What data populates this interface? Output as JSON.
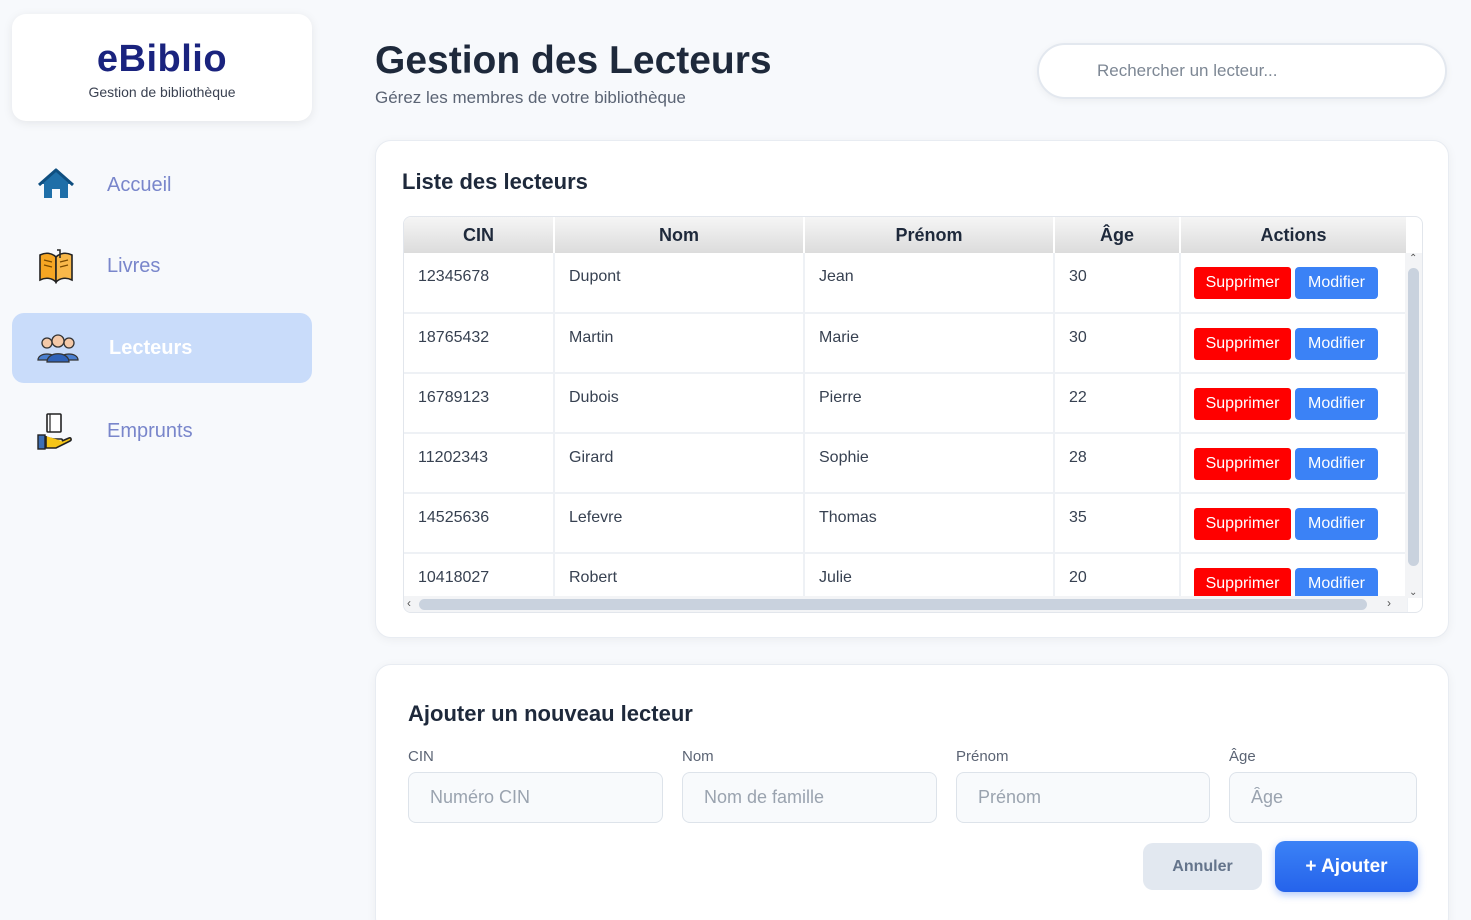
{
  "brand": {
    "title": "eBiblio",
    "subtitle": "Gestion de bibliothèque"
  },
  "sidebar": {
    "items": [
      {
        "label": "Accueil",
        "icon": "home-icon",
        "active": false
      },
      {
        "label": "Livres",
        "icon": "book-icon",
        "active": false
      },
      {
        "label": "Lecteurs",
        "icon": "readers-group-icon",
        "active": true
      },
      {
        "label": "Emprunts",
        "icon": "book-loan-hand-icon",
        "active": false
      }
    ]
  },
  "header": {
    "title": "Gestion des Lecteurs",
    "subtitle": "Gérez les membres de votre bibliothèque",
    "search_placeholder": "Rechercher un lecteur..."
  },
  "list": {
    "title": "Liste des lecteurs",
    "columns": [
      "CIN",
      "Nom",
      "Prénom",
      "Âge",
      "Actions"
    ],
    "delete_label": "Supprimer",
    "edit_label": "Modifier",
    "rows": [
      {
        "cin": "12345678",
        "nom": "Dupont",
        "prenom": "Jean",
        "age": "30"
      },
      {
        "cin": "18765432",
        "nom": "Martin",
        "prenom": "Marie",
        "age": "30"
      },
      {
        "cin": "16789123",
        "nom": "Dubois",
        "prenom": "Pierre",
        "age": "22"
      },
      {
        "cin": "11202343",
        "nom": "Girard",
        "prenom": "Sophie",
        "age": "28"
      },
      {
        "cin": "14525636",
        "nom": "Lefevre",
        "prenom": "Thomas",
        "age": "35"
      },
      {
        "cin": "10418027",
        "nom": "Robert",
        "prenom": "Julie",
        "age": "20"
      }
    ]
  },
  "form": {
    "title": "Ajouter un nouveau lecteur",
    "fields": [
      {
        "label": "CIN",
        "placeholder": "Numéro CIN",
        "value": ""
      },
      {
        "label": "Nom",
        "placeholder": "Nom de famille",
        "value": ""
      },
      {
        "label": "Prénom",
        "placeholder": "Prénom",
        "value": ""
      },
      {
        "label": "Âge",
        "placeholder": "Âge",
        "value": ""
      }
    ],
    "cancel_label": "Annuler",
    "add_label": "+ Ajouter"
  },
  "colors": {
    "brand": "#1a237e",
    "nav_text": "#7986cb",
    "nav_active_bg": "#c9dcfa",
    "delete": "#ff0000",
    "edit": "#3b82f6",
    "primary": "#2563eb"
  }
}
